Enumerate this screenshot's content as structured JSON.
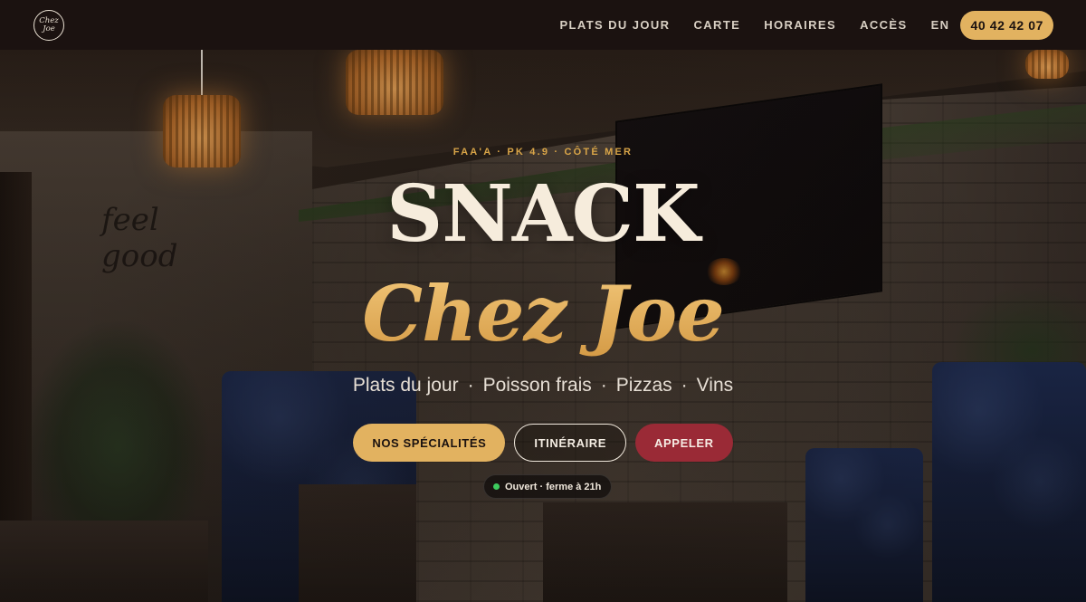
{
  "header": {
    "logo_line1": "Chez",
    "logo_line2": "Joe",
    "nav": [
      {
        "label": "PLATS DU JOUR"
      },
      {
        "label": "CARTE"
      },
      {
        "label": "HORAIRES"
      },
      {
        "label": "ACCÈS"
      }
    ],
    "lang": "EN",
    "phone": "40 42 42 07"
  },
  "hero": {
    "tagline": "FAA'A · PK 4.9 · CÔTÉ MER",
    "title": "SNACK",
    "title_script": "Chez Joe",
    "subtitle_items": [
      "Plats du jour",
      "Poisson frais",
      "Pizzas",
      "Vins"
    ],
    "subtitle_separator": "·",
    "buttons": {
      "specialites": "NOS SPÉCIALITÉS",
      "itineraire": "ITINÉRAIRE",
      "appeler": "APPELER"
    },
    "status": "Ouvert · ferme à 21h"
  },
  "background": {
    "wall_art_line1": "feel",
    "wall_art_line2": "good"
  },
  "colors": {
    "accent_gold": "#e2b260",
    "accent_red": "#9a2a36",
    "status_green": "#3dcb5e",
    "header_bg": "#1b1210"
  }
}
